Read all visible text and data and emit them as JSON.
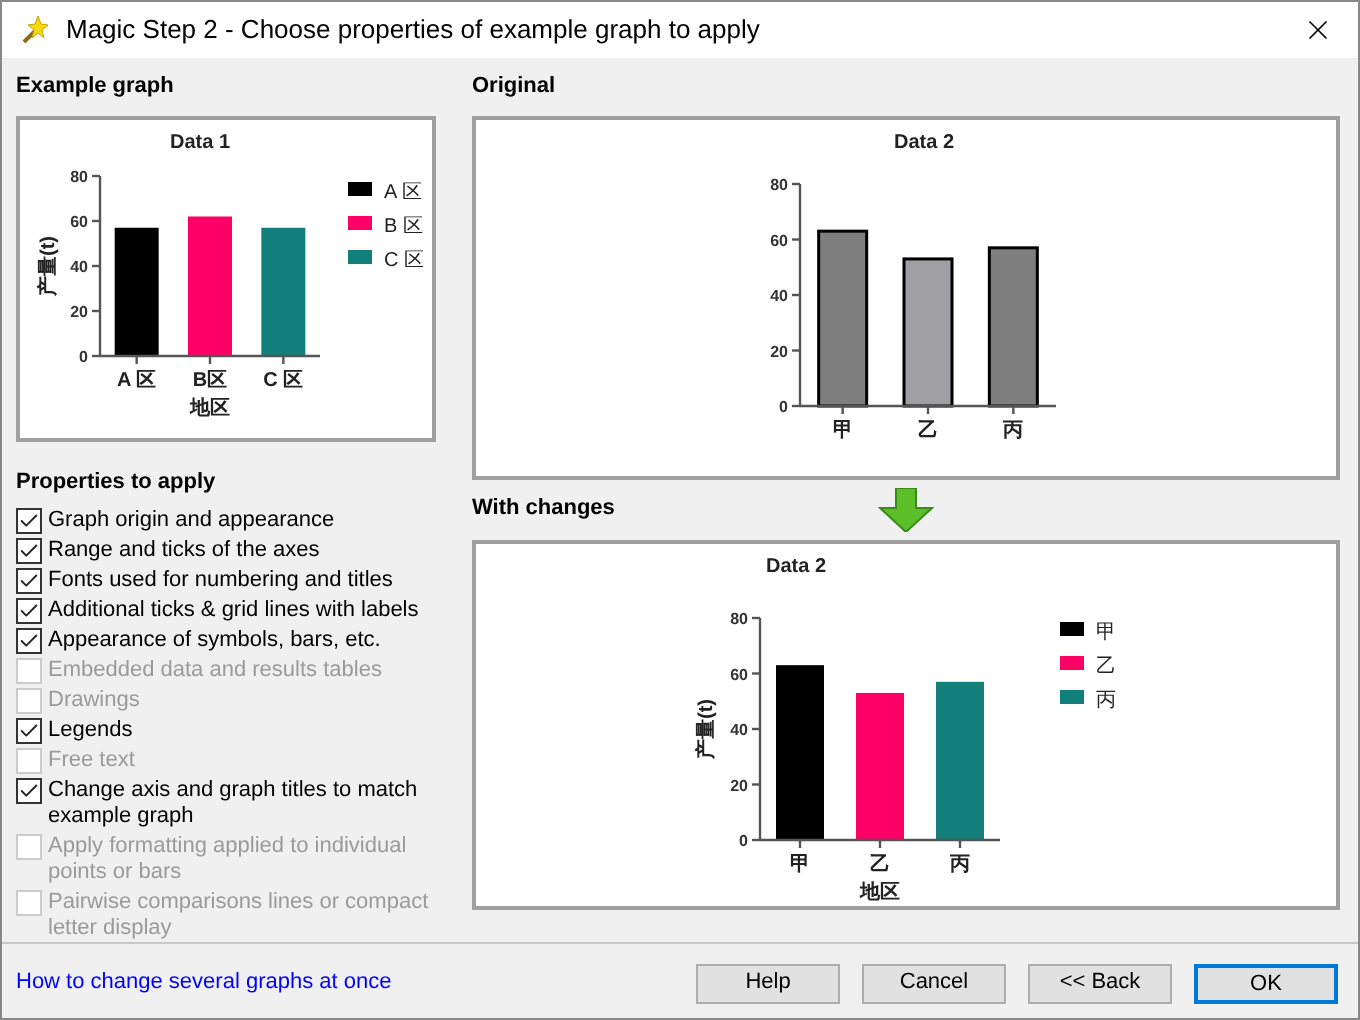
{
  "window": {
    "title": "Magic Step 2 - Choose properties of example graph to apply"
  },
  "example": {
    "heading": "Example graph",
    "chart_data": {
      "type": "bar",
      "legend": "right",
      "title": "Data 1",
      "xlabel": "地区",
      "ylabel": "产量(t)",
      "categories": [
        "A 区",
        "B区",
        "C 区"
      ],
      "ylim": [
        0,
        80
      ],
      "yticks": [
        0,
        20,
        40,
        60,
        80
      ],
      "series": [
        {
          "name": "A 区",
          "color": "#000000",
          "values": [
            57,
            null,
            null
          ]
        },
        {
          "name": "B 区",
          "color": "#ff0066",
          "values": [
            null,
            62,
            null
          ]
        },
        {
          "name": "C 区",
          "color": "#127f7b",
          "values": [
            null,
            null,
            57
          ]
        }
      ]
    }
  },
  "original": {
    "heading": "Original",
    "chart_data": {
      "type": "bar",
      "title": "Data 2",
      "categories": [
        "甲",
        "乙",
        "丙"
      ],
      "ylim": [
        0,
        80
      ],
      "yticks": [
        0,
        20,
        40,
        60,
        80
      ],
      "series": [
        {
          "color": "#7f7f7f",
          "values": [
            63,
            null,
            null
          ]
        },
        {
          "color": "#a0a0a4",
          "values": [
            null,
            53,
            null
          ]
        },
        {
          "color": "#7f7f7f",
          "values": [
            null,
            null,
            57
          ]
        }
      ]
    }
  },
  "with_changes": {
    "heading": "With changes",
    "chart_data": {
      "type": "bar",
      "legend": "right",
      "title": "Data 2",
      "xlabel": "地区",
      "ylabel": "产量(t)",
      "categories": [
        "甲",
        "乙",
        "丙"
      ],
      "ylim": [
        0,
        80
      ],
      "yticks": [
        0,
        20,
        40,
        60,
        80
      ],
      "series": [
        {
          "name": "甲",
          "color": "#000000",
          "values": [
            63,
            null,
            null
          ]
        },
        {
          "name": "乙",
          "color": "#ff0066",
          "values": [
            null,
            53,
            null
          ]
        },
        {
          "name": "丙",
          "color": "#127f7b",
          "values": [
            null,
            null,
            57
          ]
        }
      ]
    }
  },
  "properties": {
    "heading": "Properties to apply",
    "items": [
      {
        "label": "Graph origin and appearance",
        "checked": true,
        "disabled": false
      },
      {
        "label": "Range and ticks of the axes",
        "checked": true,
        "disabled": false
      },
      {
        "label": "Fonts used for numbering and titles",
        "checked": true,
        "disabled": false
      },
      {
        "label": "Additional ticks & grid lines with labels",
        "checked": true,
        "disabled": false
      },
      {
        "label": "Appearance of symbols, bars, etc.",
        "checked": true,
        "disabled": false
      },
      {
        "label": "Embedded data and results tables",
        "checked": false,
        "disabled": true
      },
      {
        "label": "Drawings",
        "checked": false,
        "disabled": true
      },
      {
        "label": "Legends",
        "checked": true,
        "disabled": false
      },
      {
        "label": "Free text",
        "checked": false,
        "disabled": true
      },
      {
        "label": "Change axis and graph titles to match example graph",
        "checked": true,
        "disabled": false
      },
      {
        "label": "Apply formatting applied to individual points or bars",
        "checked": false,
        "disabled": true
      },
      {
        "label": "Pairwise comparisons lines or compact letter display",
        "checked": false,
        "disabled": true
      }
    ]
  },
  "help_link": "How to change several graphs at once",
  "buttons": [
    {
      "label": "Help",
      "default": false
    },
    {
      "label": "Cancel",
      "default": false
    },
    {
      "label": "<< Back",
      "default": false
    },
    {
      "label": "OK",
      "default": true
    }
  ]
}
